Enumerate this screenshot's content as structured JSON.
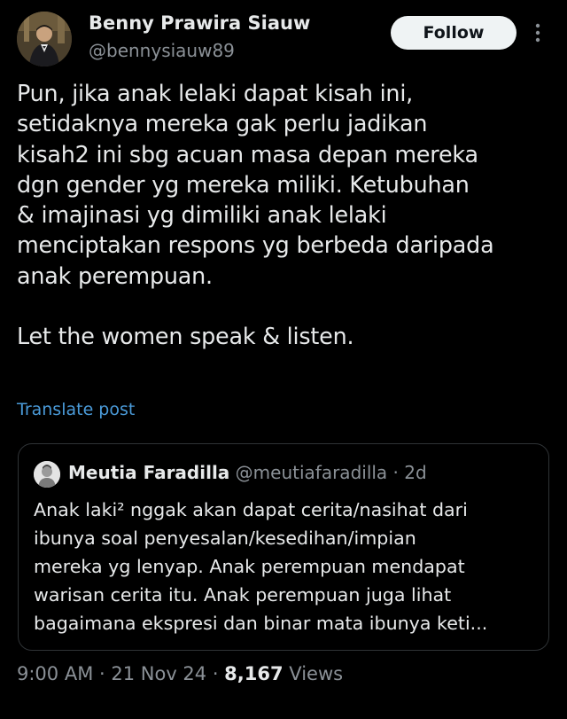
{
  "author": {
    "name": "Benny Prawira Siauw",
    "handle": "@bennysiauw89"
  },
  "follow_label": "Follow",
  "post": {
    "text": "Pun, jika anak lelaki dapat kisah ini,\nsetidaknya mereka gak perlu jadikan\nkisah2 ini sbg acuan masa depan mereka\ndgn gender yg mereka miliki. Ketubuhan\n& imajinasi yg dimiliki anak lelaki\nmenciptakan respons yg berbeda daripada\nanak perempuan.\n\nLet the women speak & listen.",
    "translate_label": "Translate post"
  },
  "quote": {
    "name": "Meutia Faradilla",
    "handle": "@meutiafaradilla",
    "separator": " · ",
    "age": "2d",
    "text": "Anak laki² nggak akan dapat cerita/nasihat dari\nibunya soal penyesalan/kesedihan/impian\nmereka yg lenyap. Anak perempuan mendapat\nwarisan cerita itu. Anak perempuan juga lihat\nbagaimana ekspresi dan binar mata ibunya keti..."
  },
  "meta": {
    "time": "9:00 AM",
    "separator": " · ",
    "date": "21 Nov 24",
    "views_count": "8,167",
    "views_label": " Views"
  },
  "colors": {
    "background": "#000000",
    "text_primary": "#e7e9ea",
    "text_secondary": "#8b9197",
    "link": "#4a9ad8",
    "follow_button_bg": "#eff3f4",
    "border": "#2f3336"
  },
  "icons": {
    "more": "more-vertical-icon"
  }
}
